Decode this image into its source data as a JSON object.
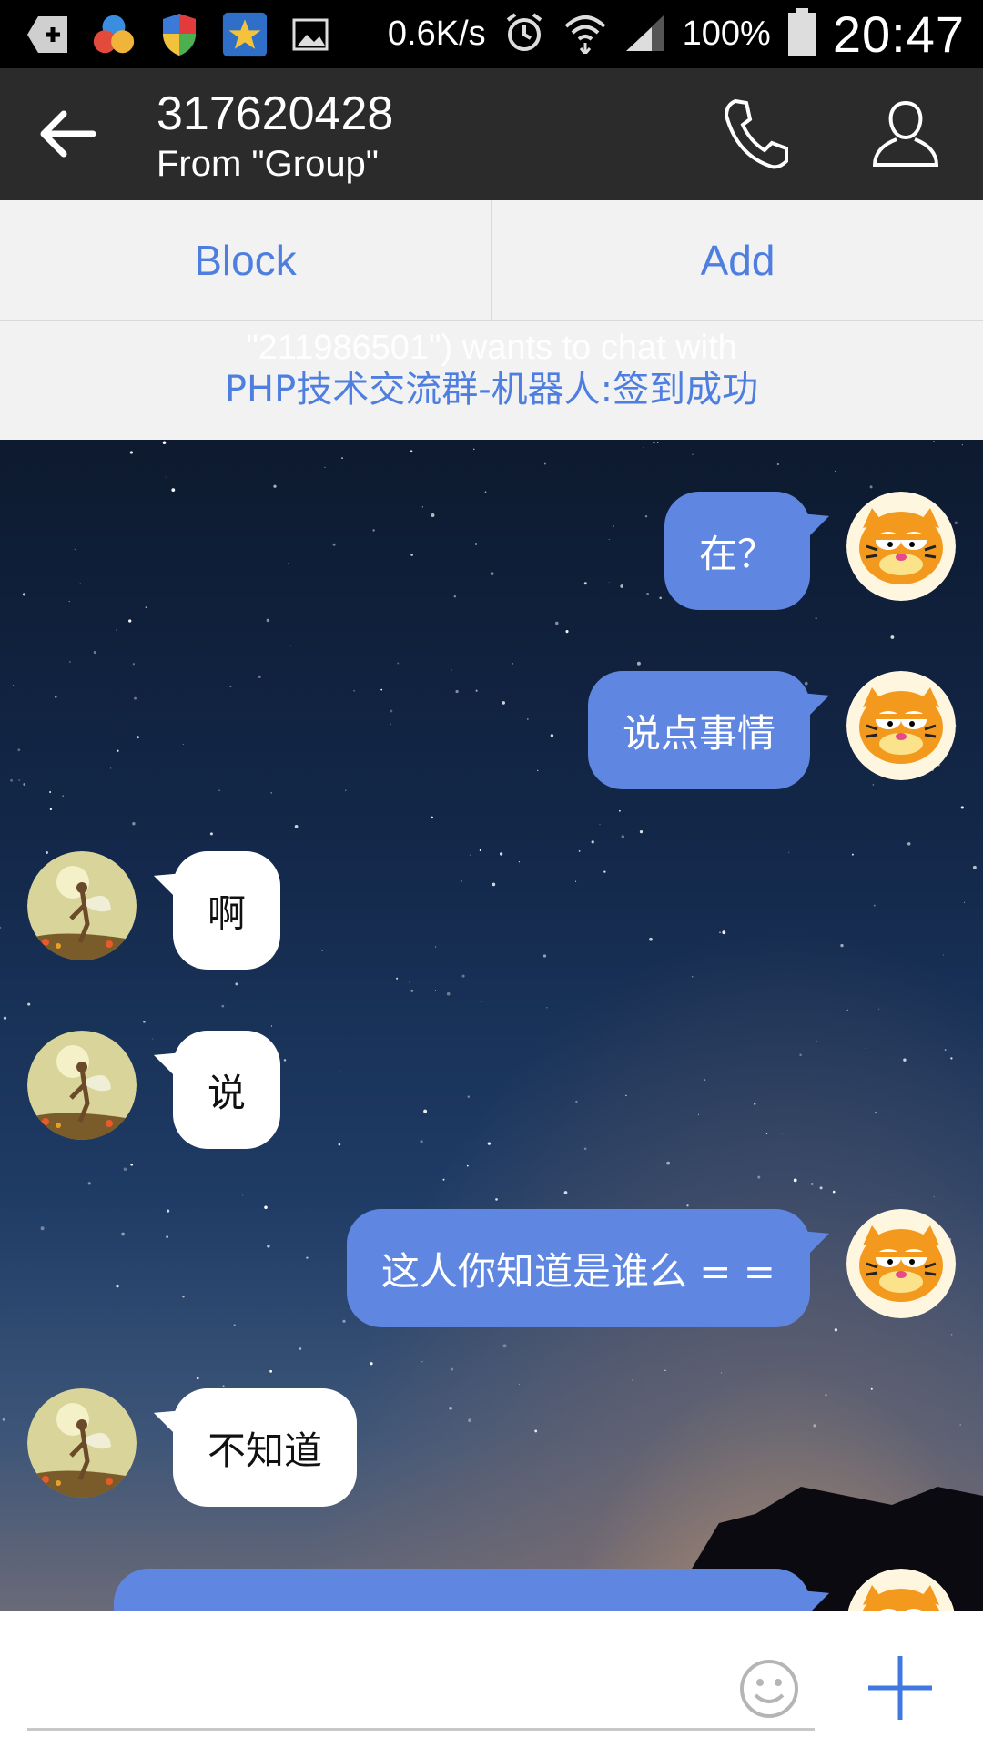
{
  "status_bar": {
    "net_speed": "0.6K/s",
    "battery": "100%",
    "time": "20:47",
    "icons": [
      "add-notification-icon",
      "color-app-icon",
      "shield-icon",
      "star-app-icon",
      "image-icon",
      "alarm-icon",
      "wifi-icon",
      "signal-icon",
      "battery-icon"
    ]
  },
  "header": {
    "title": "317620428",
    "subtitle": "From \"Group\"",
    "icons": [
      "back-arrow-icon",
      "phone-icon",
      "profile-icon"
    ]
  },
  "actions": {
    "block_label": "Block",
    "add_label": "Add"
  },
  "notice": {
    "ghost_text": "\"211986501\") wants to chat with",
    "text": "PHP技术交流群-机器人:签到成功"
  },
  "messages": [
    {
      "side": "out",
      "text": "在？"
    },
    {
      "side": "out",
      "text": "说点事情"
    },
    {
      "side": "in",
      "text": "啊"
    },
    {
      "side": "in",
      "text": "说"
    },
    {
      "side": "out",
      "text": "这人你知道是谁么 = ="
    },
    {
      "side": "in",
      "text": "不知道"
    },
    {
      "side": "out",
      "text": ""
    }
  ],
  "input": {
    "value": "",
    "placeholder": ""
  },
  "colors": {
    "accent": "#4e7fe0",
    "outgoing_bubble": "#5f86e0",
    "incoming_bubble": "#ffffff",
    "titlebar": "#2b2b2b"
  }
}
